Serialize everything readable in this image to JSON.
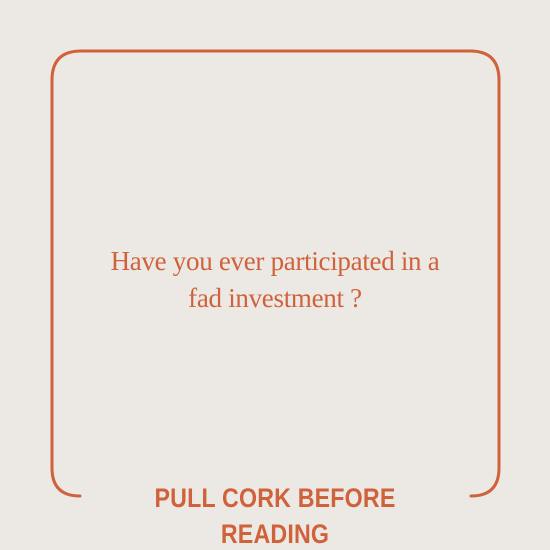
{
  "card": {
    "question_line1": "Have you ever participated in a",
    "question_line2": "fad investment ?",
    "footer": "PULL CORK BEFORE READING"
  },
  "colors": {
    "background": "#ece8e4",
    "accent": "#d0623b"
  }
}
